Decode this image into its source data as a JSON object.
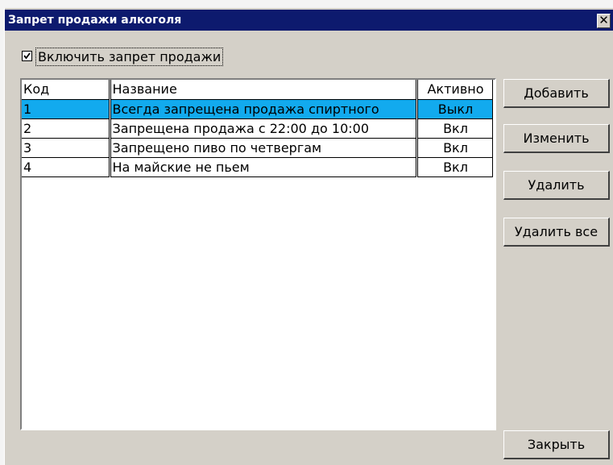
{
  "window": {
    "title": "Запрет продажи алкоголя",
    "close_glyph": "✕",
    "title_bar_color": "#0d1a6e",
    "background_color": "#d4d0c8"
  },
  "options": {
    "enable_ban_label": "Включить запрет продажи",
    "enable_ban_checked": true
  },
  "table": {
    "columns": [
      "Код",
      "Название",
      "Активно"
    ],
    "rows": [
      {
        "code": "1",
        "name": "Всегда запрещена продажа спиртного",
        "active": "Выкл",
        "selected": true
      },
      {
        "code": "2",
        "name": "Запрещена продажа с 22:00 до 10:00",
        "active": "Вкл",
        "selected": false
      },
      {
        "code": "3",
        "name": "Запрещено пиво по четвергам",
        "active": "Вкл",
        "selected": false
      },
      {
        "code": "4",
        "name": "На майские не пьем",
        "active": "Вкл",
        "selected": false
      }
    ],
    "selection_color": "#12aaee"
  },
  "buttons": {
    "add": "Добавить",
    "edit": "Изменить",
    "delete": "Удалить",
    "delete_all": "Удалить все",
    "close": "Закрыть"
  }
}
